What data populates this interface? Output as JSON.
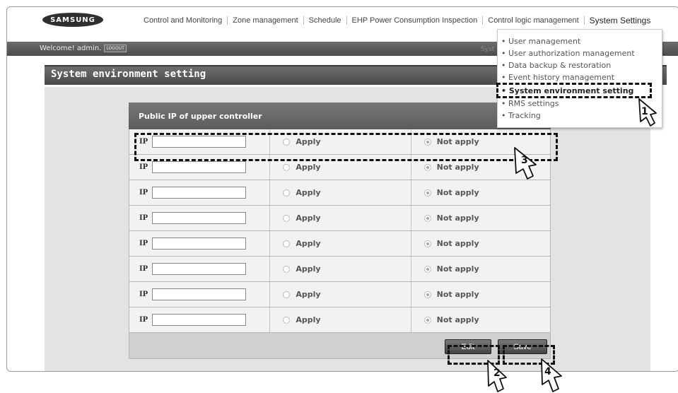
{
  "brand": "SAMSUNG",
  "nav": {
    "items": [
      "Control and Monitoring",
      "Zone management",
      "Schedule",
      "EHP Power Consumption Inspection",
      "Control logic management",
      "System Settings"
    ]
  },
  "welcome": {
    "text": "Welcome! admin.",
    "logout": "LOGOUT"
  },
  "header_ghost": "Syst",
  "page_title": "System environment setting",
  "table": {
    "header": "Public IP of upper controller",
    "ip_label": "IP",
    "apply_label": "Apply",
    "not_apply_label": "Not apply",
    "rows": [
      {
        "ip": "",
        "selected": "not_apply"
      },
      {
        "ip": "",
        "selected": "not_apply"
      },
      {
        "ip": "",
        "selected": "not_apply"
      },
      {
        "ip": "",
        "selected": "not_apply"
      },
      {
        "ip": "",
        "selected": "not_apply"
      },
      {
        "ip": "",
        "selected": "not_apply"
      },
      {
        "ip": "",
        "selected": "not_apply"
      },
      {
        "ip": "",
        "selected": "not_apply"
      }
    ]
  },
  "buttons": {
    "edit": "Edit",
    "save": "Save"
  },
  "dropdown": {
    "items": [
      "• User management",
      "• User authorization management",
      "• Data backup & restoration",
      "• Event history management",
      "• System environment setting",
      "• RMS settings",
      "• Tracking"
    ],
    "selected_index": 4
  },
  "callouts": [
    "1",
    "2",
    "3",
    "4"
  ]
}
